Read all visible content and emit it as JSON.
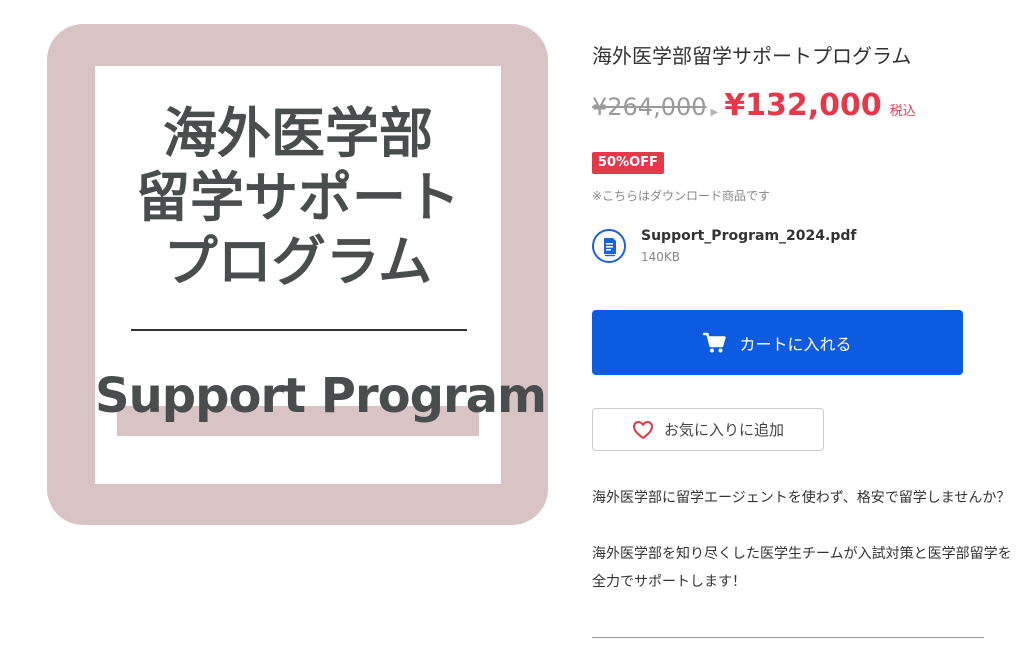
{
  "product_image": {
    "title_lines": [
      "海外医学部",
      "留学サポート",
      "プログラム"
    ],
    "subtitle": "Support Program",
    "frame_color": "#d8c4c5"
  },
  "product": {
    "title": "海外医学部留学サポートプログラム",
    "original_price": "¥264,000",
    "sale_price": "¥132,000",
    "tax_label": "税込",
    "discount_badge": "50%OFF",
    "download_note": "※こちらはダウンロード商品です",
    "price_color": "#e5394a"
  },
  "file": {
    "icon": "document-icon",
    "name": "Support_Program_2024.pdf",
    "size": "140KB"
  },
  "actions": {
    "cart_icon": "cart-icon",
    "cart_label": "カートに入れる",
    "cart_color": "#0d5be1",
    "wishlist_icon": "heart-icon",
    "wishlist_label": "お気に入りに追加"
  },
  "description": {
    "paragraph1": "海外医学部に留学エージェントを使わず、格安で留学しませんか？",
    "paragraph2": "海外医学部を知り尽くした医学生チームが入試対策と医学部留学を全力でサポートします！"
  }
}
